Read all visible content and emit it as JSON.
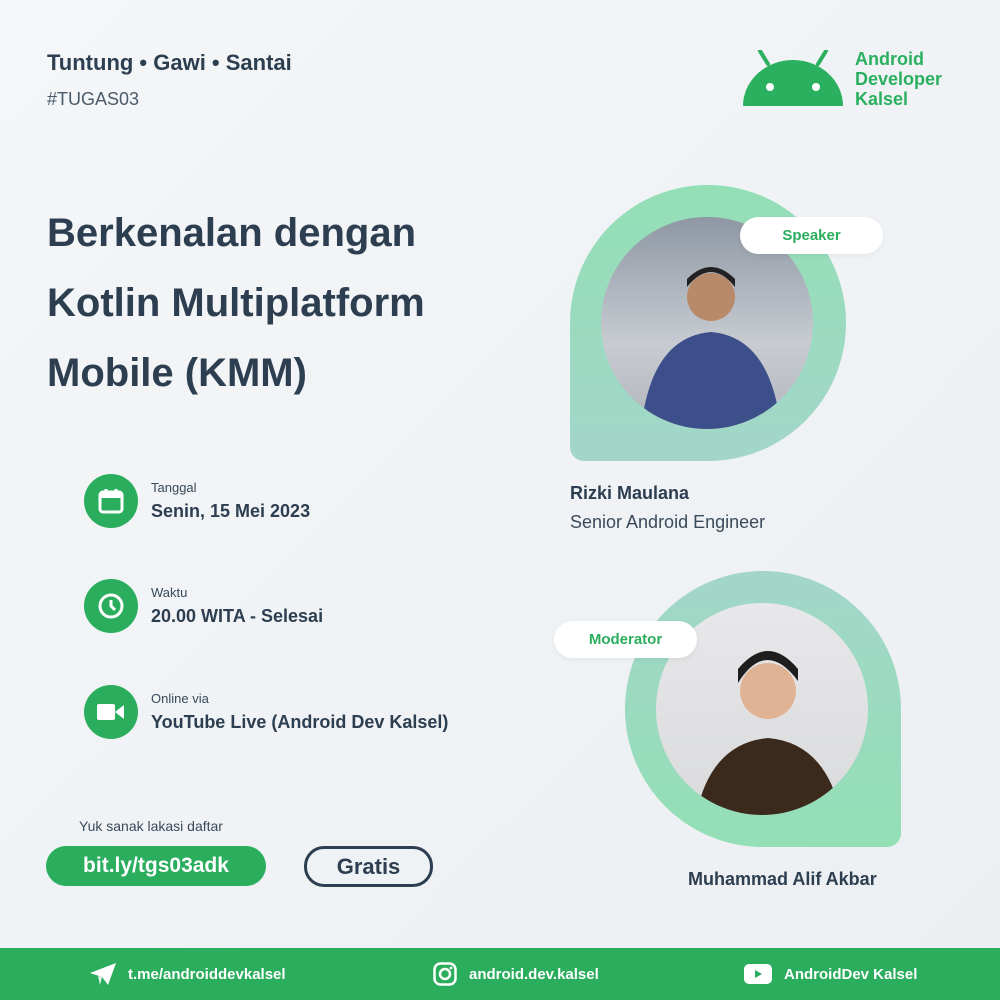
{
  "header": {
    "tagline": "Tuntung • Gawi • Santai",
    "hashtag": "#TUGAS03"
  },
  "logo": {
    "text_line1": "Android",
    "text_line2": "Developer",
    "text_line3": "Kalsel",
    "icon": "android-head-icon"
  },
  "title": {
    "line1": "Berkenalan dengan",
    "line2": "Kotlin Multiplatform",
    "line3": "Mobile (KMM)"
  },
  "info": [
    {
      "icon": "calendar-icon",
      "label": "Tanggal",
      "value": "Senin, 15 Mei 2023"
    },
    {
      "icon": "clock-icon",
      "label": "Waktu",
      "value": "20.00 WITA - Selesai"
    },
    {
      "icon": "video-camera-icon",
      "label": "Online via",
      "value": "YouTube Live (Android Dev Kalsel)"
    }
  ],
  "registration": {
    "prompt": "Yuk sanak lakasi daftar",
    "link": "bit.ly/tgs03adk",
    "price": "Gratis"
  },
  "speaker": {
    "badge": "Speaker",
    "name": "Rizki Maulana",
    "role": "Senior Android Engineer"
  },
  "moderator": {
    "badge": "Moderator",
    "name": "Muhammad Alif Akbar"
  },
  "footer": {
    "telegram": "t.me/androiddevkalsel",
    "instagram": "android.dev.kalsel",
    "youtube": "AndroidDev Kalsel"
  },
  "colors": {
    "brand_green": "#2aad5c",
    "text_dark": "#2c3e50",
    "blob_green": "#93dfb6"
  }
}
